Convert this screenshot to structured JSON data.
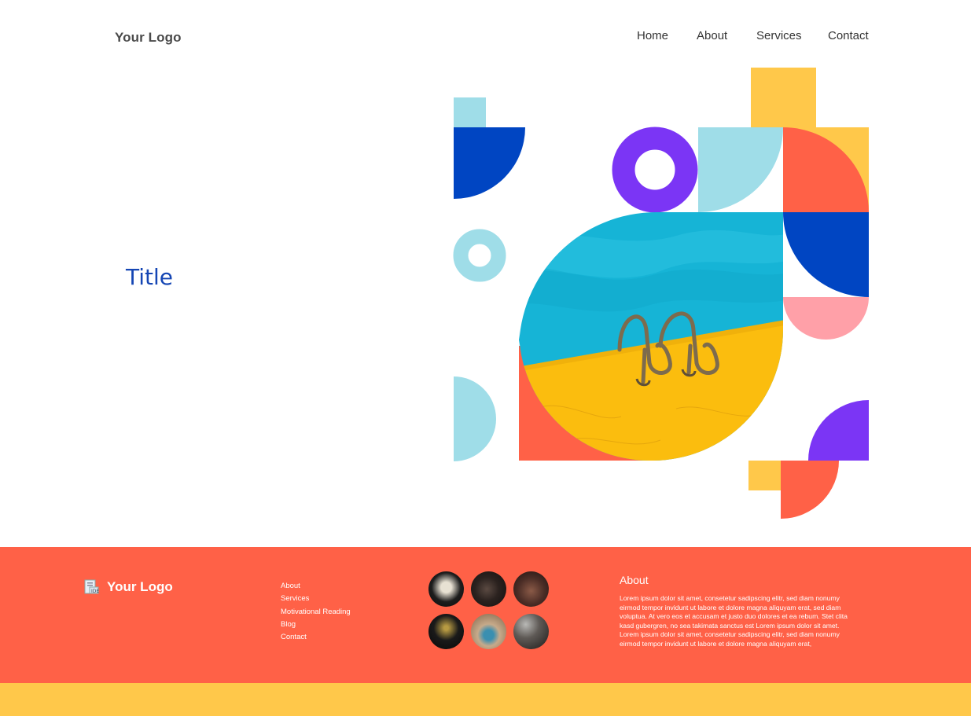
{
  "header": {
    "logo": "Your Logo",
    "nav": [
      "Home",
      "About",
      "Services",
      "Contact"
    ]
  },
  "hero": {
    "title": "Title"
  },
  "footer": {
    "logo": "Your Logo",
    "links": [
      "About",
      "Services",
      "Motivational Reading",
      "Blog",
      "Contact"
    ],
    "about_heading": "About",
    "about_text": "Lorem ipsum dolor sit amet, consetetur sadipscing elitr, sed diam nonumy eirmod tempor invidunt ut labore et dolore magna aliquyam erat, sed diam voluptua. At vero eos et accusam et justo duo dolores et ea rebum. Stet clita kasd gubergren, no sea takimata sanctus est Lorem ipsum dolor sit amet. Lorem ipsum dolor sit amet, consetetur sadipscing elitr, sed diam nonumy eirmod tempor invidunt ut labore et dolore magna aliquyam erat,"
  },
  "colors": {
    "coral": "#ff6147",
    "yellow": "#ffc84a",
    "blue": "#0045c2",
    "light_blue": "#9fdde8",
    "purple": "#7b35f5",
    "pink": "#ffa0a8",
    "title_blue": "#1546b4"
  }
}
